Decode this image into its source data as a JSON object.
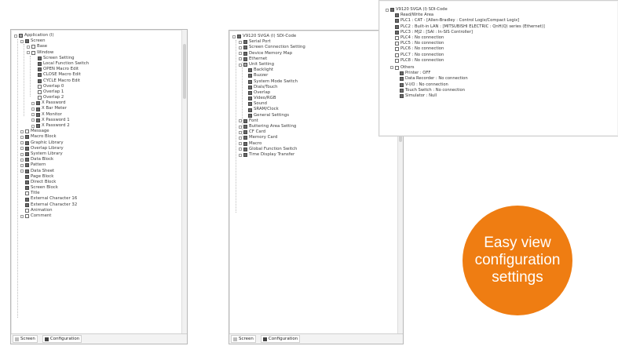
{
  "colors": {
    "accent_orange": "#ef7d12",
    "panel_border": "#b8b8b8",
    "text": "#3b3b3b"
  },
  "panel1": {
    "items": [
      "Application (I)",
      "Screen",
      "Base",
      "Window",
      "Screen Setting",
      "Local Function Switch",
      "OPEN Macro Edit",
      "CLOSE Macro Edit",
      "CYCLE Macro Edit",
      "Overlap 0",
      "Overlap 1",
      "Overlap 2",
      "X Password",
      "X Bar Meter",
      "X Monitor",
      "X Password 1",
      "X Password 2",
      "Message",
      "Macro Block",
      "Graphic Library",
      "Overlap Library",
      "System Library",
      "Data Block",
      "Pattern",
      "Data Sheet",
      "Page Block",
      "Direct Block",
      "Screen Block",
      "Title",
      "External Character 16",
      "External Character 32",
      "Animation",
      "Comment"
    ],
    "tabs": [
      "Screen",
      "Configuration"
    ]
  },
  "panel2": {
    "items": [
      "V9120 SVGA (I) SDI-Code",
      "Serial Port",
      "Screen Connection Setting",
      "Device Memory Map",
      "Ethernet",
      "Unit Setting",
      "Backlight",
      "Buzzer",
      "System Mode Switch",
      "Dials/Touch",
      "Overlap",
      "Video/RGB",
      "Sound",
      "SRAM/Clock",
      "General Settings",
      "Font",
      "Buttering Area Setting",
      "CF Card",
      "Memory Card",
      "Macro",
      "Global Function Switch",
      "Time Display Transfer"
    ],
    "tabs": [
      "Screen",
      "Configuration"
    ]
  },
  "popup": {
    "items": [
      "V9120 SVGA (I) SDI-Code",
      "Read/Write Area",
      "PLC1 : CAT - [Allen-Bradley : Control Logix/Compact Logix]",
      "PLC2 : Built-in LAN : [MITSUBISHI ELECTRIC : QnH(Q) series (Ethernet)]",
      "PLC3 : MJ2 : [SAI : In-SIS Controller]",
      "PLC4 : No connection",
      "PLC5 : No connection",
      "PLC6 : No connection",
      "PLC7 : No connection",
      "PLC8 : No connection",
      "Others",
      "Printer : OFF",
      "Data Recorder : No connection",
      "V-I/O : No connection",
      "Touch Switch : No connection",
      "Simulator : Null"
    ]
  },
  "badge": {
    "text": "Easy view configuration settings"
  }
}
